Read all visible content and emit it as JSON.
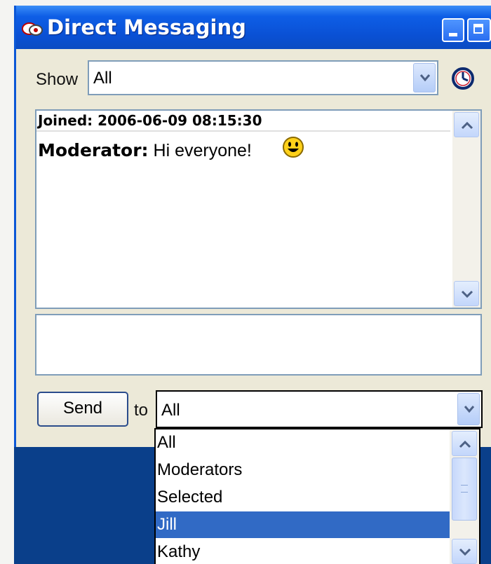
{
  "window": {
    "title": "Direct Messaging"
  },
  "toolbar": {
    "show_label": "Show",
    "show_selected": "All"
  },
  "chat": {
    "joined": "Joined: 2006-06-09 08:15:30",
    "messages": [
      {
        "sender": "Moderator:",
        "text": "Hi everyone!",
        "emoticon": "smiley-icon"
      }
    ]
  },
  "composer": {
    "input_value": "",
    "send_label": "Send",
    "to_label": "to",
    "to_selected": "All"
  },
  "recipient_dropdown": {
    "options": [
      "All",
      "Moderators",
      "Selected",
      "Jill",
      "Kathy"
    ],
    "highlighted": "Jill"
  },
  "colors": {
    "titlebar": "#0a50d4",
    "window_bg": "#ece9d8",
    "selection": "#316ac5",
    "desktop": "#0a3f8a"
  }
}
